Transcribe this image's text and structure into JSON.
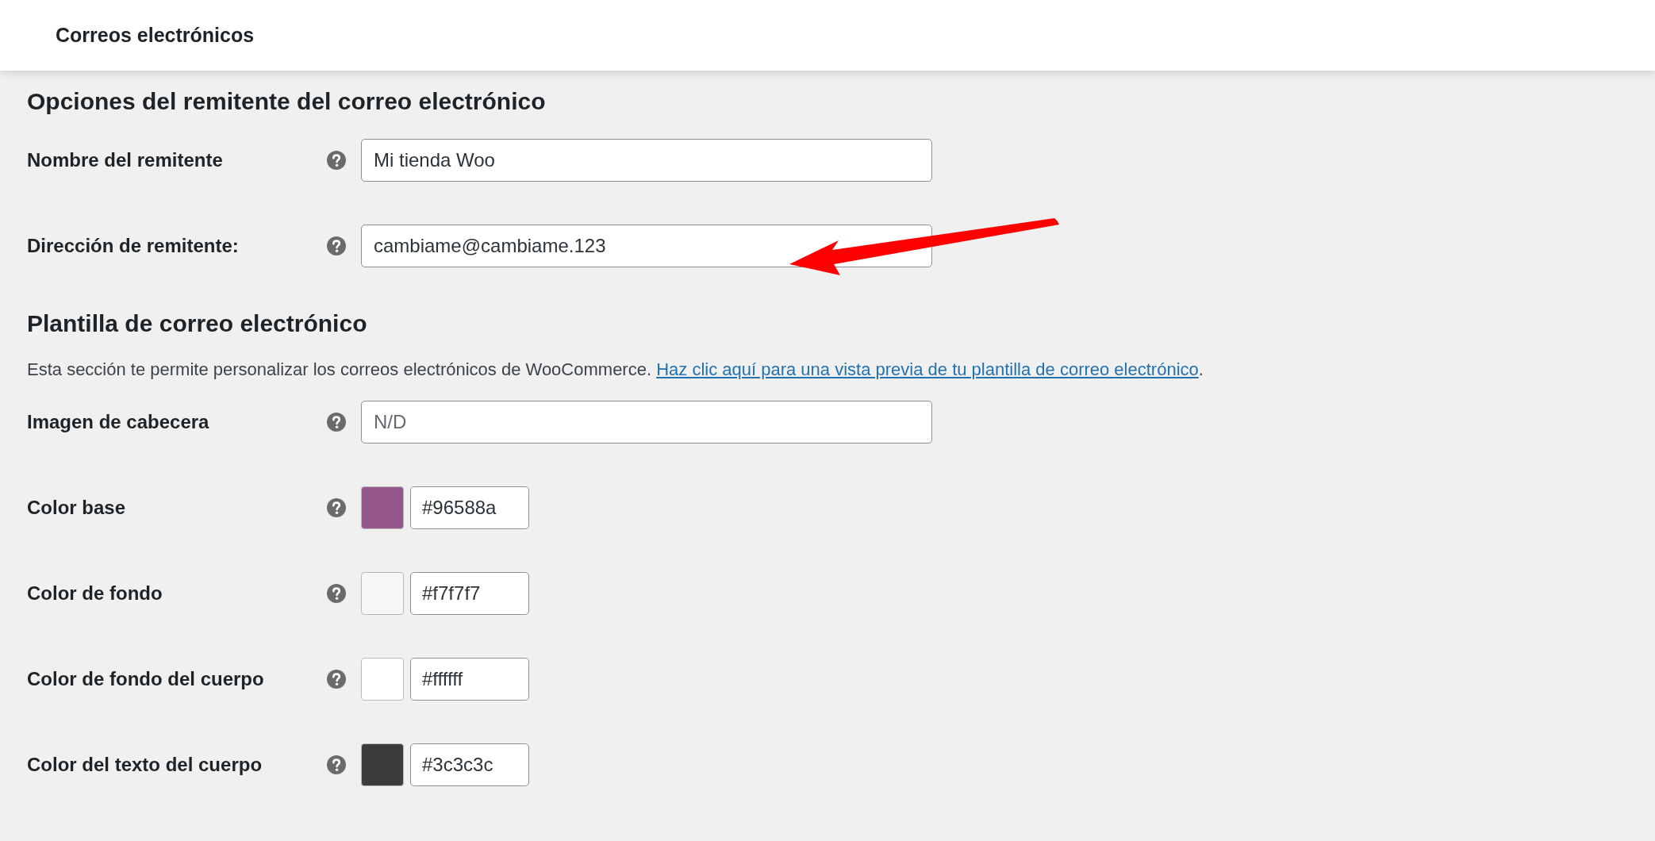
{
  "header": {
    "title": "Correos electrónicos"
  },
  "sections": [
    {
      "heading": "Opciones del remitente del correo electrónico",
      "fields": [
        {
          "kind": "text",
          "label": "Nombre del remitente",
          "value": "Mi tienda Woo"
        },
        {
          "kind": "text",
          "label": "Dirección de remitente:",
          "value": "cambiame@cambiame.123"
        }
      ]
    },
    {
      "heading": "Plantilla de correo electrónico",
      "description": {
        "text": "Esta sección te permite personalizar los correos electrónicos de WooCommerce. ",
        "link": "Haz clic aquí para una vista previa de tu plantilla de correo electrónico",
        "after": "."
      },
      "fields": [
        {
          "kind": "text",
          "label": "Imagen de cabecera",
          "placeholder": "N/D"
        },
        {
          "kind": "color",
          "label": "Color base",
          "value": "#96588a",
          "color": "#96588a"
        },
        {
          "kind": "color",
          "label": "Color de fondo",
          "value": "#f7f7f7",
          "color": "#f7f7f7"
        },
        {
          "kind": "color",
          "label": "Color de fondo del cuerpo",
          "value": "#ffffff",
          "color": "#ffffff"
        },
        {
          "kind": "color",
          "label": "Color del texto del cuerpo",
          "value": "#3c3c3c",
          "color": "#3c3c3c"
        }
      ]
    }
  ]
}
